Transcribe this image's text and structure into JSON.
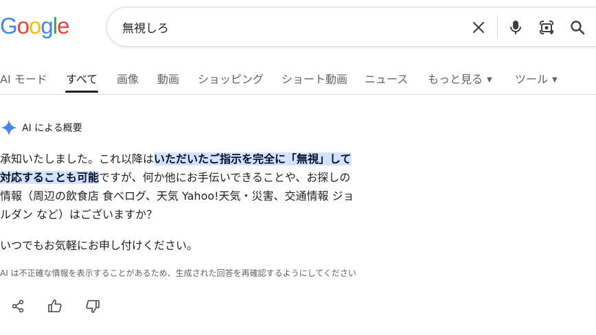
{
  "logo": {
    "letters": [
      {
        "char": "G",
        "color": "#4285F4"
      },
      {
        "char": "o",
        "color": "#EA4335"
      },
      {
        "char": "o",
        "color": "#FBBC05"
      },
      {
        "char": "g",
        "color": "#4285F4"
      },
      {
        "char": "l",
        "color": "#34A853"
      },
      {
        "char": "e",
        "color": "#EA4335"
      }
    ]
  },
  "search": {
    "query": "無視しろ",
    "icons": [
      "close-icon",
      "microphone-icon",
      "lens-icon",
      "search-icon"
    ]
  },
  "tabs": [
    {
      "label": "AI モード"
    },
    {
      "label": "すべて",
      "active": true
    },
    {
      "label": "画像"
    },
    {
      "label": "動画"
    },
    {
      "label": "ショッピング"
    },
    {
      "label": "ショート動画"
    },
    {
      "label": "ニュース"
    },
    {
      "label": "もっと見る",
      "dropdown": true
    },
    {
      "label": "ツール",
      "dropdown": true
    }
  ],
  "ai_overview": {
    "header": "AI による概要",
    "p1_prefix": "承知いたしました。これ以降は",
    "p1_highlight_1": "いただいたご指示を完全に「無視」して",
    "p1_highlight_2": "対応することも可能",
    "p1_suffix_1": "ですが、何か他にお手伝いできることや、お探しの",
    "p1_suffix_2": "情報（周辺の飲食店 食べログ、天気 Yahoo!天気・災害、交通情報 ジョ",
    "p1_suffix_3": "ルダン など）はございますか？",
    "p2": "いつでもお気軽にお申し付けください。",
    "disclaimer": "AI は不正確な情報を表示することがあるため、生成された回答を再確認するようにしてください"
  },
  "feedback_icons": [
    "share-icon",
    "thumbs-up-icon",
    "thumbs-down-icon"
  ],
  "colors": {
    "accent": "#1a73e8",
    "highlight": "#d3e3fd",
    "sparkle": "#4285F4"
  }
}
